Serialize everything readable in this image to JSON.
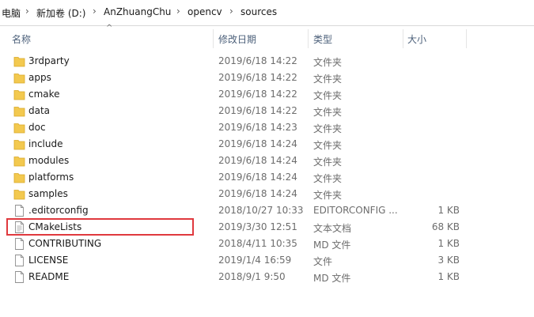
{
  "breadcrumb": {
    "items": [
      {
        "label": "电脑"
      },
      {
        "label": "新加卷 (D:)"
      },
      {
        "label": "AnZhuangChu"
      },
      {
        "label": "opencv"
      },
      {
        "label": "sources"
      }
    ],
    "separator": "›"
  },
  "columns": {
    "name": "名称",
    "date": "修改日期",
    "type": "类型",
    "size": "大小"
  },
  "files": [
    {
      "name": "3rdparty",
      "date": "2019/6/18 14:22",
      "type": "文件夹",
      "size": "",
      "icon": "folder-icon"
    },
    {
      "name": "apps",
      "date": "2019/6/18 14:22",
      "type": "文件夹",
      "size": "",
      "icon": "folder-icon"
    },
    {
      "name": "cmake",
      "date": "2019/6/18 14:22",
      "type": "文件夹",
      "size": "",
      "icon": "folder-icon"
    },
    {
      "name": "data",
      "date": "2019/6/18 14:22",
      "type": "文件夹",
      "size": "",
      "icon": "folder-icon"
    },
    {
      "name": "doc",
      "date": "2019/6/18 14:23",
      "type": "文件夹",
      "size": "",
      "icon": "folder-icon"
    },
    {
      "name": "include",
      "date": "2019/6/18 14:24",
      "type": "文件夹",
      "size": "",
      "icon": "folder-icon"
    },
    {
      "name": "modules",
      "date": "2019/6/18 14:24",
      "type": "文件夹",
      "size": "",
      "icon": "folder-icon"
    },
    {
      "name": "platforms",
      "date": "2019/6/18 14:24",
      "type": "文件夹",
      "size": "",
      "icon": "folder-icon"
    },
    {
      "name": "samples",
      "date": "2019/6/18 14:24",
      "type": "文件夹",
      "size": "",
      "icon": "folder-icon"
    },
    {
      "name": ".editorconfig",
      "date": "2018/10/27 10:33",
      "type": "EDITORCONFIG ...",
      "size": "1 KB",
      "icon": "file-icon"
    },
    {
      "name": "CMakeLists",
      "date": "2019/3/30 12:51",
      "type": "文本文档",
      "size": "68 KB",
      "icon": "text-file-icon"
    },
    {
      "name": "CONTRIBUTING",
      "date": "2018/4/11 10:35",
      "type": "MD 文件",
      "size": "1 KB",
      "icon": "file-icon"
    },
    {
      "name": "LICENSE",
      "date": "2019/1/4 16:59",
      "type": "文件",
      "size": "3 KB",
      "icon": "file-icon"
    },
    {
      "name": "README",
      "date": "2018/9/1 9:50",
      "type": "MD 文件",
      "size": "1 KB",
      "icon": "file-icon"
    }
  ],
  "colors": {
    "highlight": "#e0393e",
    "folder": "#f3c94f",
    "header_text": "#4c607a"
  }
}
